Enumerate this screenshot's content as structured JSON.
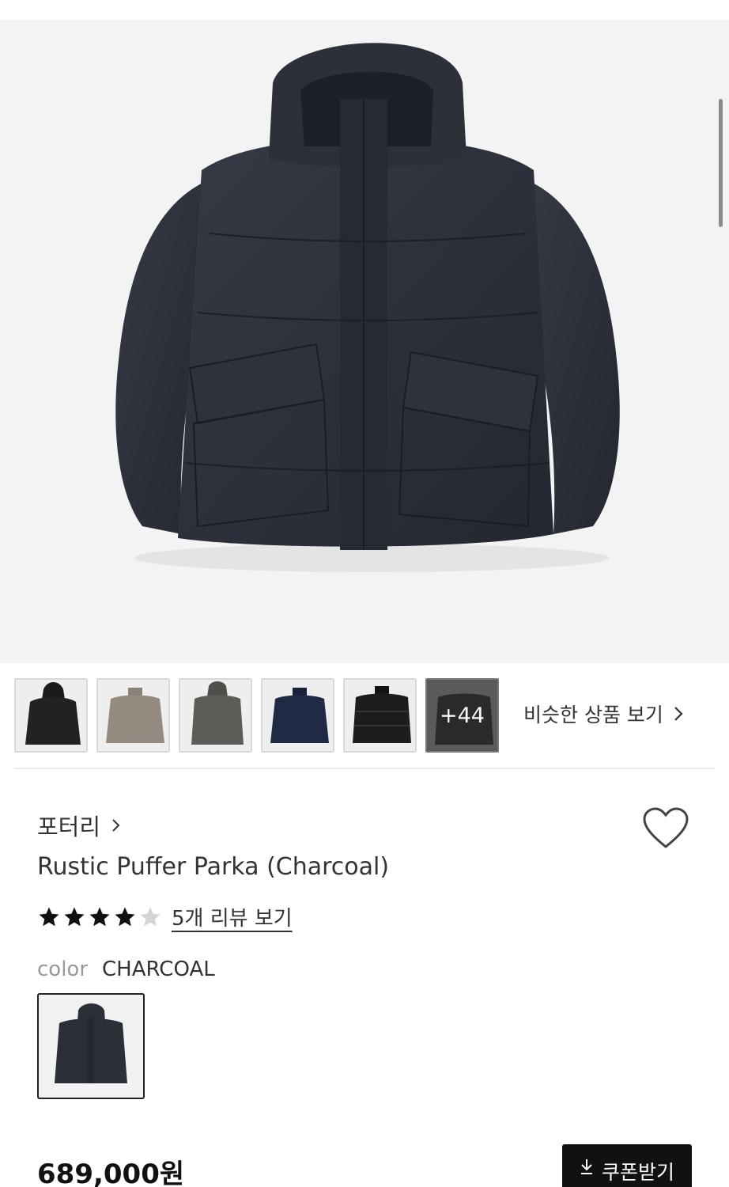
{
  "gallery": {
    "main_image_icon": "puffer-parka-image",
    "thumbnails": [
      {
        "icon": "black-hooded-puffer-thumbnail"
      },
      {
        "icon": "beige-puffer-thumbnail"
      },
      {
        "icon": "khaki-hooded-puffer-thumbnail"
      },
      {
        "icon": "navy-puffer-thumbnail"
      },
      {
        "icon": "black-quilted-puffer-thumbnail"
      }
    ],
    "more_count": "+44",
    "similar_label": "비슷한 상품 보기"
  },
  "product": {
    "brand": "포터리",
    "name": "Rustic Puffer Parka (Charcoal)",
    "rating": {
      "stars": 4,
      "max": 5
    },
    "review_link": "5개 리뷰 보기",
    "color_label": "color",
    "color_value": "CHARCOAL",
    "price": "689,000원",
    "coupon_label": "쿠폰받기"
  },
  "colors": {
    "jacket": "#2b2f38",
    "coupon_bg": "#111111"
  }
}
